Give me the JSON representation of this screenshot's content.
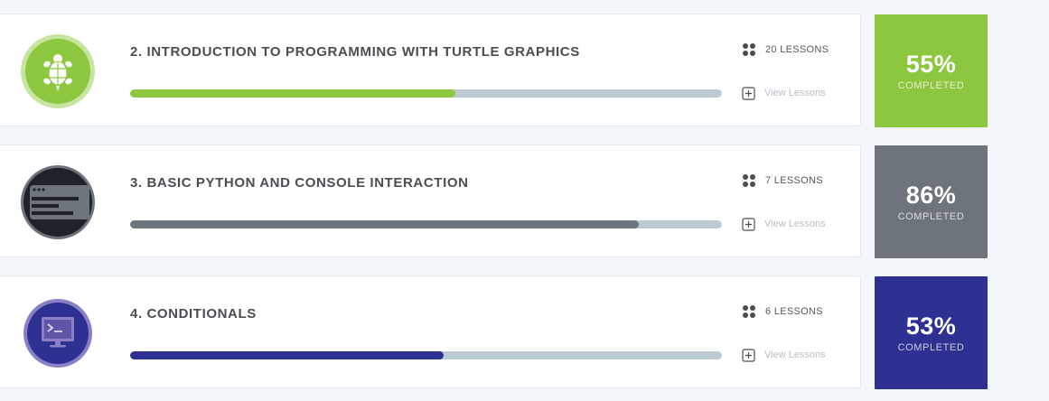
{
  "courses": [
    {
      "title": "2. INTRODUCTION TO PROGRAMMING WITH TURTLE GRAPHICS",
      "lessons_label": "20 LESSONS",
      "view_label": "View Lessons",
      "progress": 0.55,
      "completion_percent": "55%",
      "completion_label": "COMPLETED",
      "accent_color": "#8dc63f",
      "icon": "turtle-icon"
    },
    {
      "title": "3. BASIC PYTHON AND CONSOLE INTERACTION",
      "lessons_label": "7 LESSONS",
      "view_label": "View Lessons",
      "progress": 0.86,
      "completion_percent": "86%",
      "completion_label": "COMPLETED",
      "accent_color": "#6d747c",
      "icon": "console-window-icon"
    },
    {
      "title": "4. CONDITIONALS",
      "lessons_label": "6 LESSONS",
      "view_label": "View Lessons",
      "progress": 0.53,
      "completion_percent": "53%",
      "completion_label": "COMPLETED",
      "accent_color": "#2e3192",
      "icon": "terminal-monitor-icon"
    }
  ]
}
